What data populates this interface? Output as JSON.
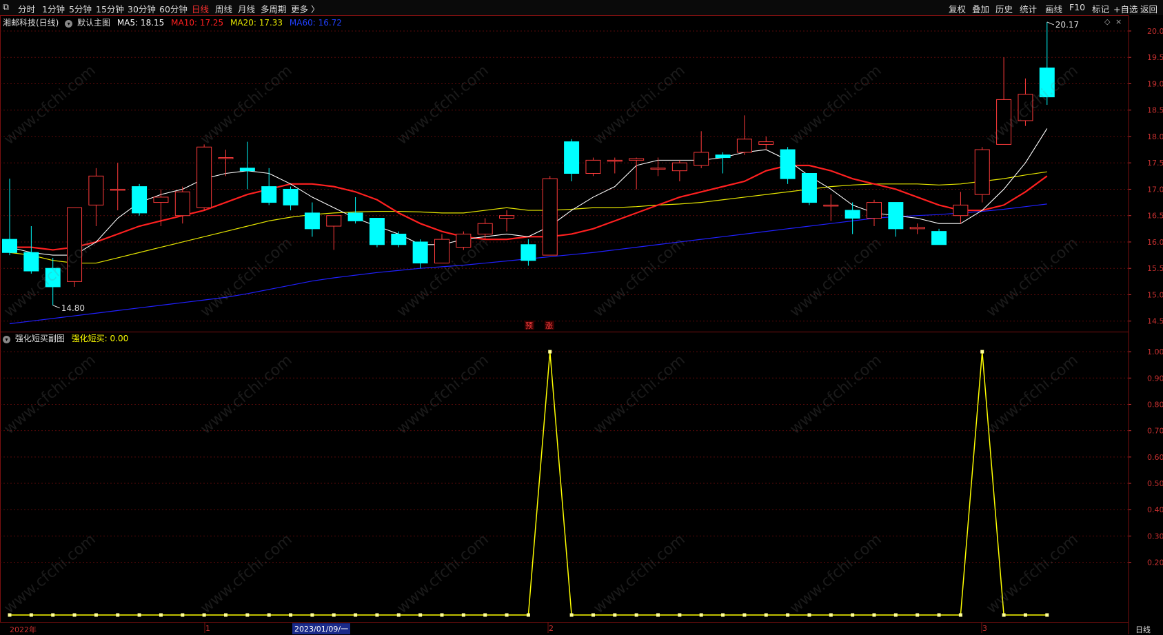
{
  "toolbar": {
    "periods": [
      "分时",
      "1分钟",
      "5分钟",
      "15分钟",
      "30分钟",
      "60分钟",
      "日线",
      "周线",
      "月线",
      "多周期",
      "更多 〉"
    ],
    "active_period": "日线",
    "right_items": [
      "复权",
      "叠加",
      "历史",
      "统计",
      "画线",
      "F10",
      "标记",
      "+自选",
      "返回"
    ]
  },
  "main_panel": {
    "stock": "湘邮科技(日线)",
    "indicator": "默认主图",
    "ma5": "MA5: 18.15",
    "ma10": "MA10: 17.25",
    "ma20": "MA20: 17.33",
    "ma60": "MA60: 16.72",
    "high_label": "20.17",
    "low_label": "14.80",
    "signal_labels": [
      "预",
      "涨"
    ]
  },
  "sub_panel": {
    "indicator": "强化短买副图",
    "value_label": "强化短买: 0.00"
  },
  "bottom_axis": {
    "labels": [
      "2022年",
      "1",
      "2023/01/09/一",
      "2",
      "3"
    ],
    "period_tag": "日线"
  },
  "watermark": "www.cfchi.com",
  "colors": {
    "up": "#ff3b3b",
    "down": "#00ffff",
    "ma5": "#ffffff",
    "ma10": "#ff2020",
    "ma20": "#e6e600",
    "ma60": "#2020ff",
    "signal": "#ffff00"
  },
  "chart_data": [
    {
      "type": "candlestick",
      "title": "湘邮科技(日线)",
      "ylim": [
        14.3,
        20.3
      ],
      "y_ticks": [
        "20.00",
        "19.50",
        "19.00",
        "18.50",
        "18.00",
        "17.50",
        "17.00",
        "16.50",
        "16.00",
        "15.50",
        "15.00",
        "14.50"
      ],
      "candles": [
        {
          "o": 16.05,
          "c": 15.8,
          "h": 17.2,
          "l": 15.75
        },
        {
          "o": 15.8,
          "c": 15.45,
          "h": 16.3,
          "l": 15.4
        },
        {
          "o": 15.5,
          "c": 15.15,
          "h": 15.7,
          "l": 14.8
        },
        {
          "o": 15.25,
          "c": 16.65,
          "h": 16.65,
          "l": 15.15
        },
        {
          "o": 16.7,
          "c": 17.25,
          "h": 17.4,
          "l": 16.3
        },
        {
          "o": 17.0,
          "c": 17.0,
          "h": 17.5,
          "l": 16.6
        },
        {
          "o": 17.05,
          "c": 16.55,
          "h": 17.1,
          "l": 16.5
        },
        {
          "o": 16.75,
          "c": 16.85,
          "h": 17.0,
          "l": 16.3
        },
        {
          "o": 16.5,
          "c": 16.95,
          "h": 17.05,
          "l": 16.35
        },
        {
          "o": 16.65,
          "c": 17.8,
          "h": 17.85,
          "l": 16.6
        },
        {
          "o": 17.6,
          "c": 17.6,
          "h": 17.75,
          "l": 17.25
        },
        {
          "o": 17.4,
          "c": 17.35,
          "h": 17.9,
          "l": 17.0
        },
        {
          "o": 17.05,
          "c": 16.75,
          "h": 17.4,
          "l": 16.7
        },
        {
          "o": 17.0,
          "c": 16.7,
          "h": 17.05,
          "l": 16.6
        },
        {
          "o": 16.55,
          "c": 16.25,
          "h": 16.75,
          "l": 16.1
        },
        {
          "o": 16.3,
          "c": 16.5,
          "h": 16.5,
          "l": 15.85
        },
        {
          "o": 16.55,
          "c": 16.4,
          "h": 16.85,
          "l": 16.35
        },
        {
          "o": 16.45,
          "c": 15.95,
          "h": 16.45,
          "l": 15.9
        },
        {
          "o": 16.15,
          "c": 15.95,
          "h": 16.2,
          "l": 15.9
        },
        {
          "o": 16.0,
          "c": 15.6,
          "h": 16.05,
          "l": 15.5
        },
        {
          "o": 15.6,
          "c": 16.05,
          "h": 16.15,
          "l": 15.6
        },
        {
          "o": 15.9,
          "c": 16.15,
          "h": 16.2,
          "l": 15.85
        },
        {
          "o": 16.15,
          "c": 16.35,
          "h": 16.45,
          "l": 16.05
        },
        {
          "o": 16.45,
          "c": 16.5,
          "h": 16.6,
          "l": 16.2
        },
        {
          "o": 15.95,
          "c": 15.65,
          "h": 16.05,
          "l": 15.55
        },
        {
          "o": 15.75,
          "c": 17.2,
          "h": 17.25,
          "l": 15.75
        },
        {
          "o": 17.9,
          "c": 17.3,
          "h": 17.95,
          "l": 17.15
        },
        {
          "o": 17.3,
          "c": 17.55,
          "h": 17.6,
          "l": 17.25
        },
        {
          "o": 17.55,
          "c": 17.55,
          "h": 17.6,
          "l": 17.3
        },
        {
          "o": 17.55,
          "c": 17.58,
          "h": 17.6,
          "l": 17.0
        },
        {
          "o": 17.4,
          "c": 17.4,
          "h": 17.6,
          "l": 17.25
        },
        {
          "o": 17.35,
          "c": 17.5,
          "h": 17.55,
          "l": 17.15
        },
        {
          "o": 17.45,
          "c": 17.7,
          "h": 18.1,
          "l": 17.4
        },
        {
          "o": 17.65,
          "c": 17.6,
          "h": 17.7,
          "l": 17.3
        },
        {
          "o": 17.7,
          "c": 17.95,
          "h": 18.4,
          "l": 17.65
        },
        {
          "o": 17.85,
          "c": 17.9,
          "h": 18.0,
          "l": 17.75
        },
        {
          "o": 17.75,
          "c": 17.2,
          "h": 17.8,
          "l": 17.1
        },
        {
          "o": 17.3,
          "c": 16.75,
          "h": 17.3,
          "l": 16.7
        },
        {
          "o": 16.7,
          "c": 16.7,
          "h": 16.9,
          "l": 16.4
        },
        {
          "o": 16.6,
          "c": 16.45,
          "h": 16.75,
          "l": 16.15
        },
        {
          "o": 16.45,
          "c": 16.75,
          "h": 16.8,
          "l": 16.3
        },
        {
          "o": 16.75,
          "c": 16.25,
          "h": 16.75,
          "l": 16.1
        },
        {
          "o": 16.25,
          "c": 16.28,
          "h": 16.35,
          "l": 16.15
        },
        {
          "o": 16.2,
          "c": 15.95,
          "h": 16.25,
          "l": 15.95
        },
        {
          "o": 16.5,
          "c": 16.7,
          "h": 16.95,
          "l": 16.35
        },
        {
          "o": 16.9,
          "c": 17.75,
          "h": 17.8,
          "l": 16.75
        },
        {
          "o": 17.85,
          "c": 18.7,
          "h": 19.5,
          "l": 17.85
        },
        {
          "o": 18.3,
          "c": 18.8,
          "h": 19.1,
          "l": 18.2
        },
        {
          "o": 19.3,
          "c": 18.75,
          "h": 20.17,
          "l": 18.6
        }
      ],
      "ma5": [
        15.9,
        15.8,
        15.75,
        15.75,
        16.0,
        16.45,
        16.75,
        16.9,
        17.0,
        17.2,
        17.3,
        17.35,
        17.3,
        17.1,
        16.85,
        16.65,
        16.45,
        16.3,
        16.15,
        15.95,
        15.95,
        16.05,
        16.1,
        16.15,
        16.1,
        16.3,
        16.6,
        16.85,
        17.05,
        17.45,
        17.55,
        17.55,
        17.55,
        17.6,
        17.7,
        17.75,
        17.55,
        17.25,
        17.0,
        16.7,
        16.55,
        16.5,
        16.45,
        16.35,
        16.35,
        16.6,
        17.0,
        17.5,
        18.15
      ],
      "ma10": [
        15.9,
        15.9,
        15.85,
        15.9,
        16.0,
        16.15,
        16.3,
        16.4,
        16.5,
        16.6,
        16.75,
        16.9,
        17.0,
        17.1,
        17.1,
        17.05,
        16.95,
        16.8,
        16.55,
        16.35,
        16.2,
        16.1,
        16.05,
        16.05,
        16.1,
        16.1,
        16.15,
        16.25,
        16.4,
        16.55,
        16.7,
        16.85,
        16.95,
        17.05,
        17.15,
        17.35,
        17.45,
        17.45,
        17.35,
        17.2,
        17.1,
        17.0,
        16.85,
        16.7,
        16.6,
        16.6,
        16.7,
        16.95,
        17.25
      ],
      "ma20": [
        15.8,
        15.75,
        15.65,
        15.6,
        15.6,
        15.7,
        15.8,
        15.9,
        16.0,
        16.1,
        16.2,
        16.3,
        16.4,
        16.47,
        16.52,
        16.55,
        16.57,
        16.58,
        16.58,
        16.57,
        16.55,
        16.55,
        16.6,
        16.65,
        16.6,
        16.6,
        16.62,
        16.65,
        16.65,
        16.67,
        16.7,
        16.72,
        16.75,
        16.8,
        16.85,
        16.9,
        16.95,
        17.0,
        17.05,
        17.08,
        17.1,
        17.1,
        17.1,
        17.08,
        17.1,
        17.15,
        17.2,
        17.27,
        17.33
      ],
      "ma60": [
        14.45,
        14.5,
        14.55,
        14.6,
        14.65,
        14.7,
        14.75,
        14.8,
        14.85,
        14.9,
        14.95,
        15.02,
        15.1,
        15.18,
        15.26,
        15.32,
        15.37,
        15.42,
        15.46,
        15.5,
        15.53,
        15.56,
        15.6,
        15.64,
        15.68,
        15.72,
        15.76,
        15.8,
        15.85,
        15.9,
        15.95,
        16.0,
        16.05,
        16.1,
        16.15,
        16.2,
        16.25,
        16.3,
        16.35,
        16.4,
        16.45,
        16.48,
        16.5,
        16.52,
        16.55,
        16.58,
        16.62,
        16.67,
        16.72
      ]
    },
    {
      "type": "line",
      "title": "强化短买副图",
      "ylim": [
        0,
        1.05
      ],
      "y_ticks": [
        "1.00",
        "0.90",
        "0.80",
        "0.70",
        "0.60",
        "0.50",
        "0.40",
        "0.30",
        "0.20"
      ],
      "series": [
        {
          "name": "强化短买",
          "values": [
            0,
            0,
            0,
            0,
            0,
            0,
            0,
            0,
            0,
            0,
            0,
            0,
            0,
            0,
            0,
            0,
            0,
            0,
            0,
            0,
            0,
            0,
            0,
            0,
            0,
            1,
            0,
            0,
            0,
            0,
            0,
            0,
            0,
            0,
            0,
            0,
            0,
            0,
            0,
            0,
            0,
            0,
            0,
            0,
            0,
            1,
            0,
            0,
            0
          ]
        }
      ]
    }
  ]
}
